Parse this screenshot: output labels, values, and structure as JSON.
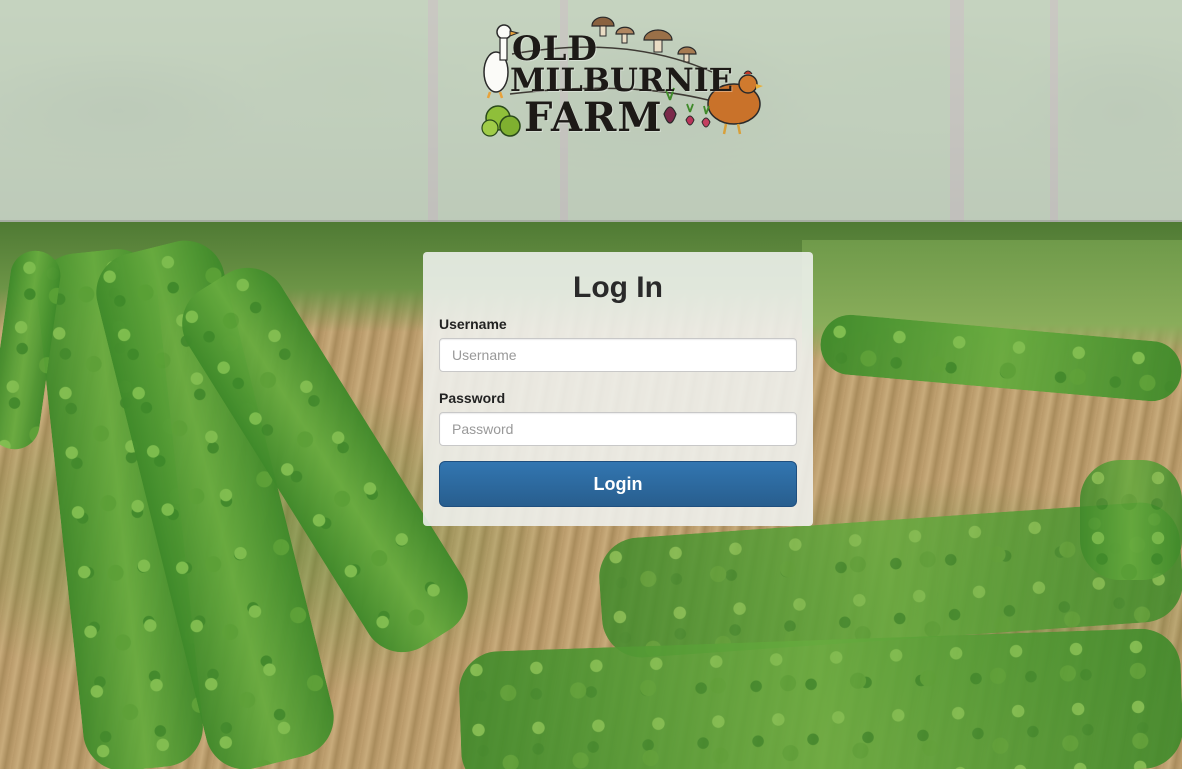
{
  "brand": {
    "logo_line1": "OLD",
    "logo_line2": "MILBURNIE",
    "logo_line3": "FARM",
    "logo_icons": [
      "duck-icon",
      "mushroom-icon",
      "chicken-icon",
      "vegetables-icon"
    ]
  },
  "login": {
    "title": "Log In",
    "username_label": "Username",
    "username_placeholder": "Username",
    "username_value": "",
    "password_label": "Password",
    "password_placeholder": "Password",
    "password_value": "",
    "submit_label": "Login"
  },
  "colors": {
    "button": "#285e8e",
    "panel": "#f0f2f0"
  }
}
